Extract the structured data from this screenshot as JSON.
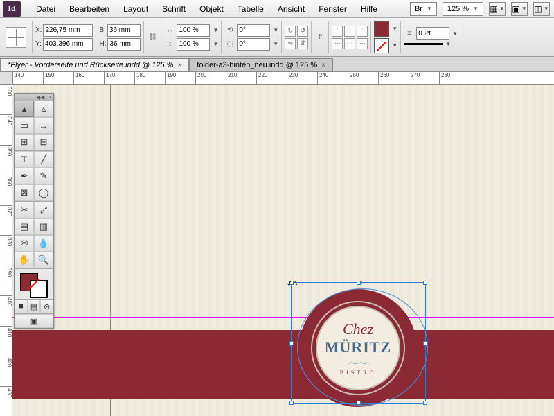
{
  "app": {
    "icon_label": "Id"
  },
  "menu": [
    "Datei",
    "Bearbeiten",
    "Layout",
    "Schrift",
    "Objekt",
    "Tabelle",
    "Ansicht",
    "Fenster",
    "Hilfe"
  ],
  "menubar_right": {
    "bridge_label": "Br",
    "zoom": "125 %"
  },
  "controlbar": {
    "x_label": "X:",
    "x_value": "226,75 mm",
    "y_label": "Y:",
    "y_value": "403,396 mm",
    "w_label": "B:",
    "w_value": "36 mm",
    "h_label": "H:",
    "h_value": "36 mm",
    "scale_x": "100 %",
    "scale_y": "100 %",
    "rotate": "0°",
    "shear": "0°",
    "stroke_weight": "0 Pt"
  },
  "tabs": [
    {
      "label": "*Flyer - Vorderseite und Rückseite.indd @ 125 %",
      "active": true
    },
    {
      "label": "folder-a3-hinten_neu.indd @ 125 %",
      "active": false
    }
  ],
  "ruler_h": [
    "140",
    "150",
    "160",
    "170",
    "180",
    "190",
    "200",
    "210",
    "220",
    "230",
    "240",
    "250",
    "260",
    "270",
    "280"
  ],
  "ruler_v": [
    "330",
    "340",
    "350",
    "360",
    "370",
    "380",
    "390",
    "400",
    "410",
    "420",
    "430"
  ],
  "logo": {
    "chez": "Chez",
    "name": "MÜRITZ",
    "bistro": "BISTRO"
  },
  "tooltips": {
    "selection": "Auswahl",
    "direct": "Direktauswahl",
    "page": "Seite",
    "gap": "Lücke",
    "content_collector": "Inhaltssammler",
    "content_placer": "Inhaltsplatzierung",
    "type": "Text",
    "line": "Linie",
    "pen": "Zeichenstift",
    "pencil": "Buntstift",
    "rect_frame": "Rechteckrahmen",
    "ellipse": "Ellipse",
    "scissors": "Schere",
    "free_transform": "Frei transformieren",
    "gradient_swatch": "Verlaufsfarbfeld",
    "gradient_feather": "Weiche-Verlaufskante",
    "note": "Notiz",
    "eyedropper": "Pipette",
    "hand": "Hand",
    "zoom": "Zoom"
  }
}
